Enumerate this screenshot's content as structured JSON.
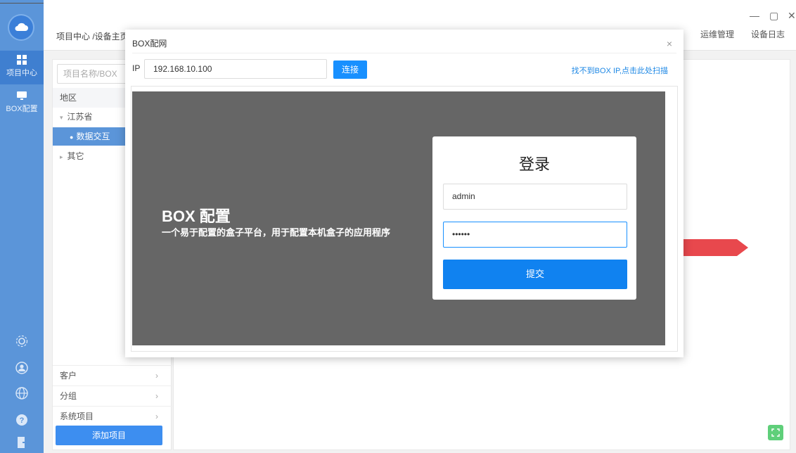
{
  "rail": {
    "items": [
      {
        "label": "项目中心"
      },
      {
        "label": "BOX配置"
      }
    ]
  },
  "header": {
    "breadcrumb": "项目中心 /设备主页",
    "nav": [
      "运维管理",
      "设备日志"
    ]
  },
  "tree": {
    "search_placeholder": "项目名称/BOX",
    "column_header": "地区",
    "nodes": [
      {
        "label": "江苏省"
      },
      {
        "label": "数据交互"
      },
      {
        "label": "其它"
      }
    ],
    "footer_items": [
      {
        "label": "客户"
      },
      {
        "label": "分组"
      },
      {
        "label": "系统项目"
      }
    ],
    "add_button": "添加项目"
  },
  "dialog": {
    "title": "BOX配网",
    "close": "×",
    "ip_label": "IP",
    "ip_value": "192.168.10.100",
    "connect_button": "连接",
    "scan_link": "找不到BOX IP,点击此处扫描",
    "panel": {
      "title": "BOX 配置",
      "subtitle": "一个易于配置的盒子平台，用于配置本机盒子的应用程序"
    },
    "login": {
      "title": "登录",
      "username": "admin",
      "password_mask": "••••••",
      "submit": "提交"
    }
  },
  "colors": {
    "rail": "#5b95d9",
    "primary": "#1890ff",
    "arrow": "#e8484d",
    "panel_bg": "#666666"
  }
}
